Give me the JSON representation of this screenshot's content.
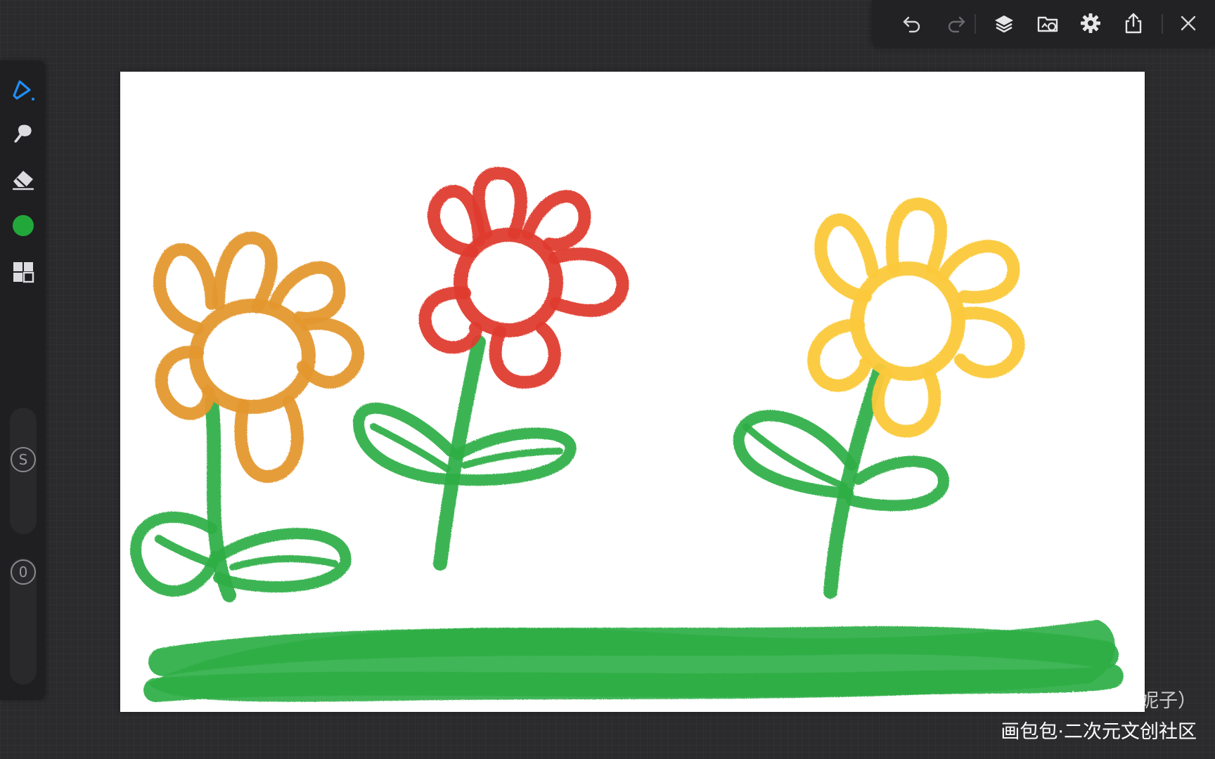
{
  "top_toolbar": {
    "icons": [
      "undo-icon",
      "redo-icon",
      "layers-icon",
      "gallery-icon",
      "settings-icon",
      "share-icon",
      "close-icon"
    ]
  },
  "left_toolbar": {
    "icons": [
      "brush-icon",
      "smudge-icon",
      "eraser-icon",
      "color-swatch",
      "grid-icon"
    ],
    "accent_color": "#1e8ff5",
    "current_color": "#22a83a",
    "size_slider_label": "S",
    "opacity_slider_label": "0"
  },
  "watermark": {
    "line1": "@忘羡羡（妮子）",
    "line2": "画包包·二次元文创社区"
  },
  "colors": {
    "orange_flower": "#e4982e",
    "red_flower": "#df3b2f",
    "yellow_flower": "#fbc93a",
    "green": "#2eae45"
  }
}
